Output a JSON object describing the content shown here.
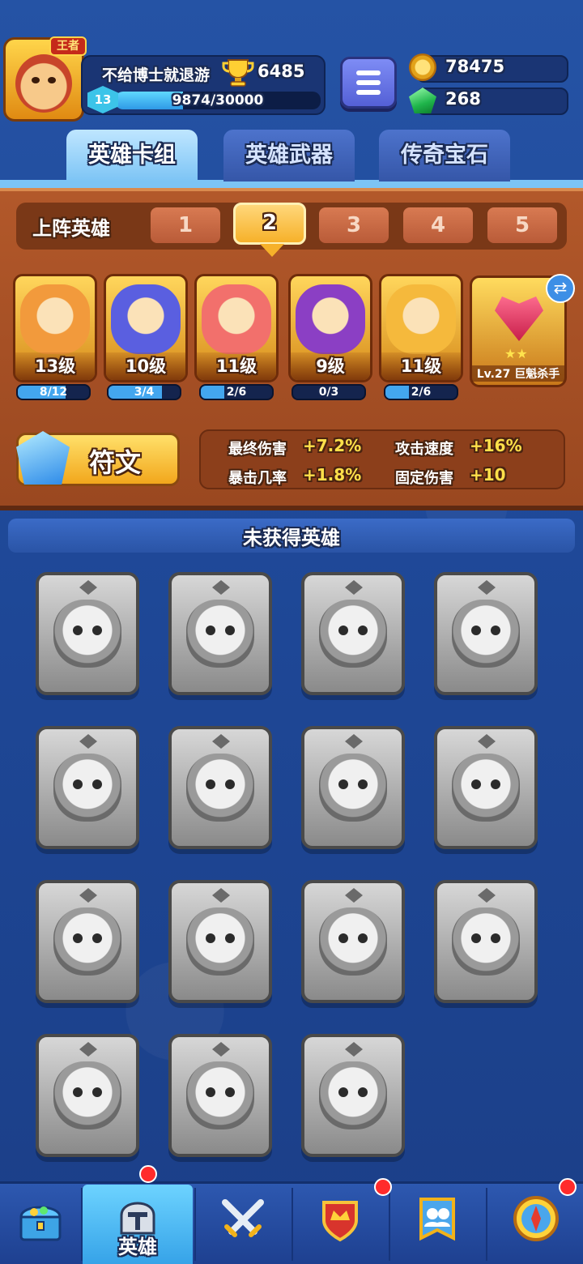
{
  "header": {
    "player_name": "不给博士就退游",
    "crown_badge": "王者",
    "trophies": "6485",
    "level": "13",
    "xp_text": "9874/30000",
    "xp_progress": 0.329,
    "gold": "78475",
    "gems": "268"
  },
  "tabs": [
    {
      "label": "英雄卡组",
      "active": true
    },
    {
      "label": "英雄武器",
      "active": false
    },
    {
      "label": "传奇宝石",
      "active": false
    }
  ],
  "deck": {
    "label": "上阵英雄",
    "slots": [
      "1",
      "2",
      "3",
      "4",
      "5"
    ],
    "active_slot": "2",
    "heroes": [
      {
        "level": "13级",
        "progress_text": "8/12",
        "progress": 0.667,
        "color": "#f29a3c"
      },
      {
        "level": "10级",
        "progress_text": "3/4",
        "progress": 0.75,
        "color": "#5a5fe0"
      },
      {
        "level": "11级",
        "progress_text": "2/6",
        "progress": 0.333,
        "color": "#f2706c"
      },
      {
        "level": "9级",
        "progress_text": "0/3",
        "progress": 0.0,
        "color": "#8b3fc4"
      },
      {
        "level": "11级",
        "progress_text": "2/6",
        "progress": 0.333,
        "color": "#f5b93c"
      }
    ],
    "relic": {
      "label": "Lv.27 巨魁杀手",
      "stars": "★★"
    }
  },
  "rune": {
    "label": "符文"
  },
  "stats": [
    {
      "label": "最终伤害",
      "value": "+7.2%"
    },
    {
      "label": "攻击速度",
      "value": "+16%"
    },
    {
      "label": "暴击几率",
      "value": "+1.8%"
    },
    {
      "label": "固定伤害",
      "value": "+10"
    }
  ],
  "locked_section": {
    "title": "未获得英雄",
    "count": 15
  },
  "bottom_nav": [
    {
      "name": "shop",
      "label": "",
      "icon": "treasure-chest-icon",
      "active": false,
      "badge": false
    },
    {
      "name": "heroes",
      "label": "英雄",
      "icon": "knight-helmet-icon",
      "active": true,
      "badge": true
    },
    {
      "name": "battle",
      "label": "",
      "icon": "crossed-swords-icon",
      "active": false,
      "badge": false
    },
    {
      "name": "guild",
      "label": "",
      "icon": "crown-shield-icon",
      "active": false,
      "badge": true
    },
    {
      "name": "social",
      "label": "",
      "icon": "friends-banner-icon",
      "active": false,
      "badge": false
    },
    {
      "name": "explore",
      "label": "",
      "icon": "compass-icon",
      "active": false,
      "badge": true
    }
  ],
  "colors": {
    "accent": "#f6b12a",
    "panel": "#9a4820",
    "background": "#1d3f86",
    "xp": "#43a6ef"
  }
}
